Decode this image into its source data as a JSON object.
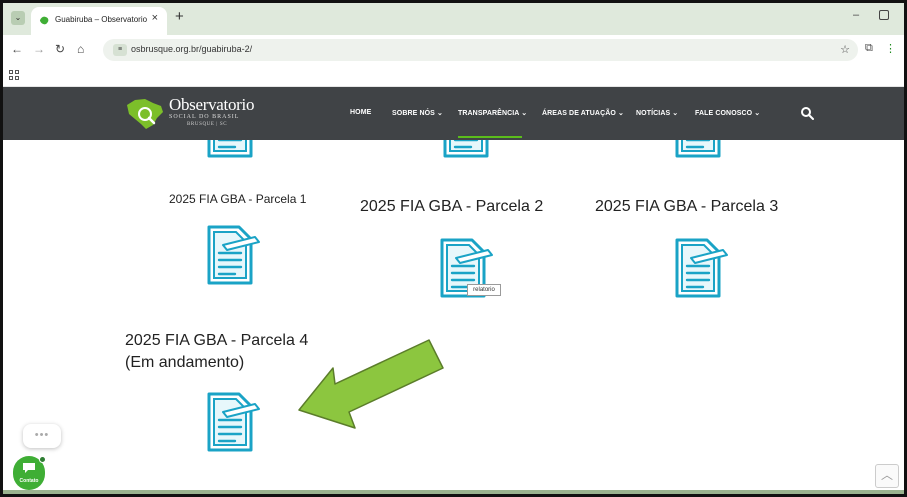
{
  "browser": {
    "tab_title": "Guabiruba – Observatorio",
    "tab_close": "×",
    "new_tab": "+",
    "url": "osbrusque.org.br/guabiruba-2/",
    "minimize": "–"
  },
  "site": {
    "logo_line1": "Observatorio",
    "logo_line2": "SOCIAL DO BRASIL",
    "logo_line3": "BRUSQUE | SC",
    "nav": [
      {
        "label": "HOME"
      },
      {
        "label": "SOBRE NÓS ⌄"
      },
      {
        "label": "TRANSPARÊNCIA ⌄"
      },
      {
        "label": "ÁREAS DE ATUAÇÃO ⌄"
      },
      {
        "label": "NOTÍCIAS ⌄"
      },
      {
        "label": "FALE CONOSCO ⌄"
      }
    ],
    "accent": "#5bbd1b"
  },
  "content": {
    "items": [
      {
        "caption": "2025 FIA GBA - Parcela 1"
      },
      {
        "caption": "2025 FIA GBA - Parcela 2"
      },
      {
        "caption": "2025 FIA GBA - Parcela 3"
      },
      {
        "caption_line1": "2025 FIA GBA - Parcela 4",
        "caption_line2": "(Em andamento)"
      }
    ],
    "tooltip": "relatorio",
    "doc_icon_color": "#1aa3c6",
    "arrow_color": "#8cc63f"
  },
  "chat": {
    "dots": "•••",
    "label": "Contato"
  },
  "scroll_top": "︿"
}
